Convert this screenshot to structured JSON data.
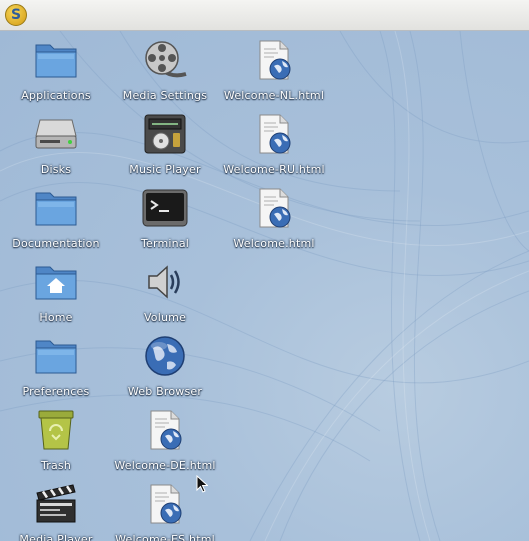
{
  "topbar": {
    "logo_letter": "S"
  },
  "desktop": {
    "icons": [
      {
        "label": "Applications",
        "icon": "folder-icon"
      },
      {
        "label": "Disks",
        "icon": "drive-icon"
      },
      {
        "label": "Documentation",
        "icon": "folder-icon"
      },
      {
        "label": "Home",
        "icon": "home-folder-icon"
      },
      {
        "label": "Preferences",
        "icon": "folder-icon"
      },
      {
        "label": "Trash",
        "icon": "trash-icon"
      },
      {
        "label": "Media Player",
        "icon": "clapperboard-icon"
      },
      {
        "label": "Media Settings",
        "icon": "film-reel-icon"
      },
      {
        "label": "Music Player",
        "icon": "music-player-icon"
      },
      {
        "label": "Terminal",
        "icon": "terminal-icon"
      },
      {
        "label": "Volume",
        "icon": "speaker-icon"
      },
      {
        "label": "Web Browser",
        "icon": "globe-icon"
      },
      {
        "label": "Welcome-DE.html",
        "icon": "html-document-icon"
      },
      {
        "label": "Welcome-ES.html",
        "icon": "html-document-icon"
      },
      {
        "label": "Welcome-NL.html",
        "icon": "html-document-icon"
      },
      {
        "label": "Welcome-RU.html",
        "icon": "html-document-icon"
      },
      {
        "label": "Welcome.html",
        "icon": "html-document-icon"
      }
    ]
  }
}
